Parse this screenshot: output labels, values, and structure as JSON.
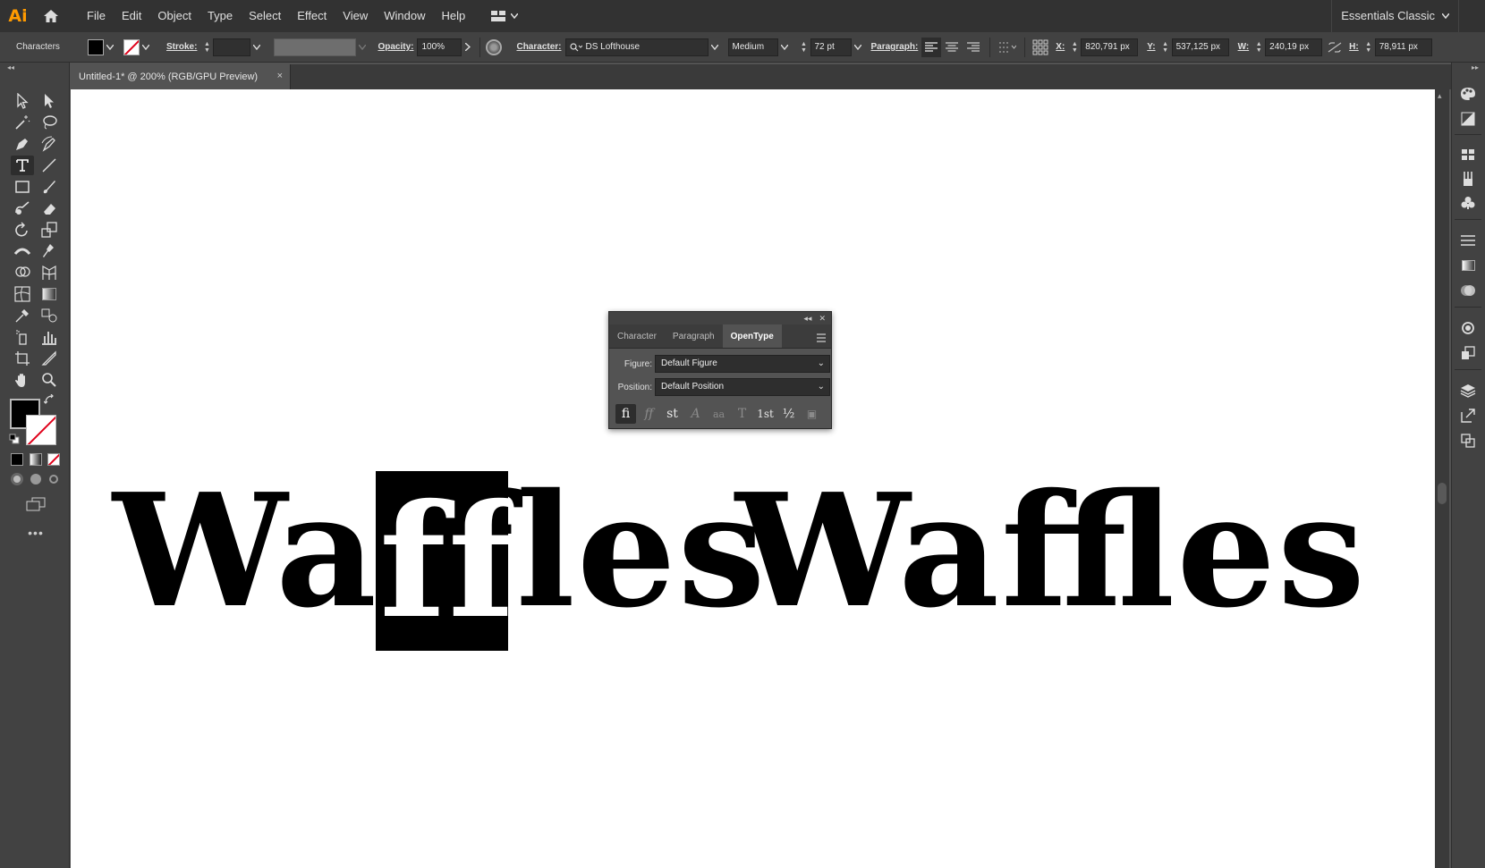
{
  "app": {
    "logo": "Ai"
  },
  "menu": [
    "File",
    "Edit",
    "Object",
    "Type",
    "Select",
    "Effect",
    "View",
    "Window",
    "Help"
  ],
  "workspace": "Essentials Classic",
  "control": {
    "selection": "Characters",
    "stroke_label": "Stroke:",
    "opacity_label": "Opacity:",
    "opacity": "100%",
    "character_label": "Character:",
    "font": "DS Lofthouse",
    "style": "Medium",
    "size": "72 pt",
    "paragraph_label": "Paragraph:",
    "x_label": "X:",
    "x": "820,791 px",
    "y_label": "Y:",
    "y": "537,125 px",
    "w_label": "W:",
    "w": "240,19 px",
    "h_label": "H:",
    "h": "78,911 px"
  },
  "doc_tab": {
    "title": "Untitled-1* @ 200% (RGB/GPU Preview)",
    "close": "×"
  },
  "artboard": {
    "word1": "Waffles",
    "word2": "Waﬄes",
    "selected_text": "ffl"
  },
  "opentype_panel": {
    "tabs": [
      "Character",
      "Paragraph",
      "OpenType"
    ],
    "active_tab": "OpenType",
    "figure_label": "Figure:",
    "figure": "Default Figure",
    "position_label": "Position:",
    "position": "Default Position",
    "glyph_buttons": [
      "fi",
      "ﬀ",
      "st",
      "A",
      "aa",
      "T",
      "1st",
      "½",
      "▣"
    ]
  },
  "colors": {
    "accent": "#ff9a00",
    "stroke_none": "#e0001a"
  }
}
